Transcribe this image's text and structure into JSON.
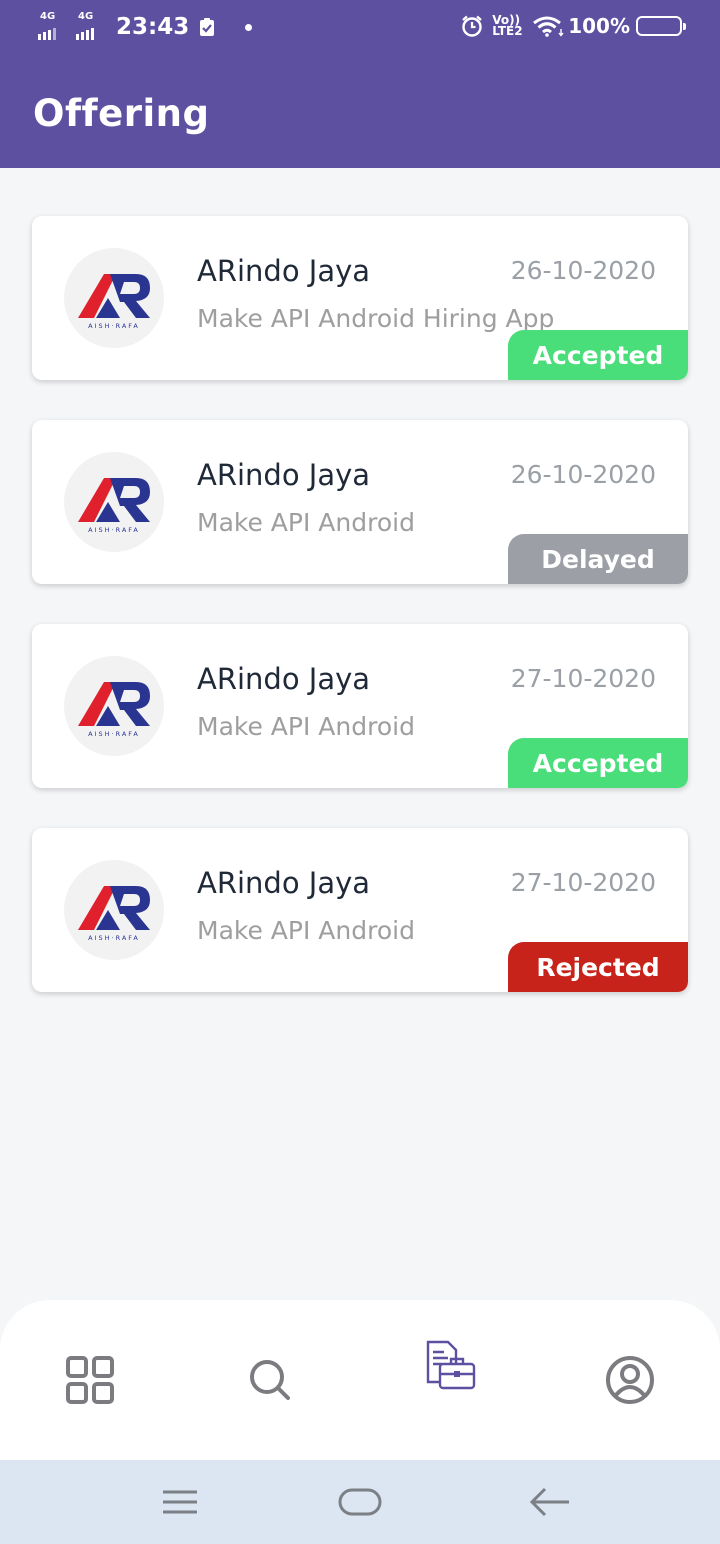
{
  "status_bar": {
    "sim1_label": "4G",
    "sim2_label": "4G",
    "time": "23:43",
    "volte_label": "Vo)) LTE2",
    "battery": "100%"
  },
  "header": {
    "title": "Offering"
  },
  "offers": [
    {
      "company": "ARindo Jaya",
      "date": "26-10-2020",
      "job": "Make API Android Hiring App",
      "status": "Accepted",
      "status_color": "#4ade7a"
    },
    {
      "company": "ARindo Jaya",
      "date": "26-10-2020",
      "job": "Make API Android",
      "status": "Delayed",
      "status_color": "#9ca0a6"
    },
    {
      "company": "ARindo Jaya",
      "date": "27-10-2020",
      "job": "Make API Android",
      "status": "Accepted",
      "status_color": "#4ade7a"
    },
    {
      "company": "ARindo Jaya",
      "date": "27-10-2020",
      "job": "Make API Android",
      "status": "Rejected",
      "status_color": "#c8231b"
    }
  ],
  "logo_text": "AISH·RAFA",
  "bottom_nav": [
    "grid-icon",
    "search-icon",
    "offering-icon",
    "profile-icon"
  ],
  "colors": {
    "primary": "#5e50a1",
    "accepted": "#4ade7a",
    "delayed": "#9ca0a6",
    "rejected": "#c8231b"
  }
}
